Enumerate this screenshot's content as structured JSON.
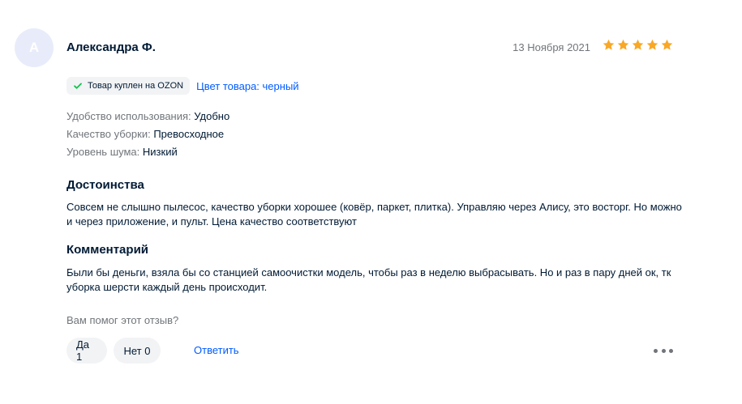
{
  "review": {
    "avatar_letter": "А",
    "author": "Александра Ф.",
    "date": "13 Ноября 2021",
    "rating": 5,
    "rating_color": "#f9a825",
    "badge": "Товар куплен на OZON",
    "color_link": "Цвет товара: черный",
    "props": [
      {
        "key": "Удобство использования:",
        "value": "Удобно"
      },
      {
        "key": "Качество уборки:",
        "value": "Превосходное"
      },
      {
        "key": "Уровень шума:",
        "value": "Низкий"
      }
    ],
    "pros_title": "Достоинства",
    "pros_text": "Совсем не слышно пылесос, качество уборки хорошее (ковёр, паркет, плитка). Управляю через Алису, это восторг. Но можно и через приложение, и пульт. Цена качество соответствуют",
    "comment_title": "Комментарий",
    "comment_text": "Были бы деньги, взяла бы со станцией самоочистки модель, чтобы раз в неделю выбрасывать. Но и раз в пару дней ок, тк уборка шерсти каждый день происходит.",
    "helpful_question": "Вам помог этот отзыв?",
    "yes_label": "Да 1",
    "no_label": "Нет 0",
    "reply_label": "Ответить"
  }
}
